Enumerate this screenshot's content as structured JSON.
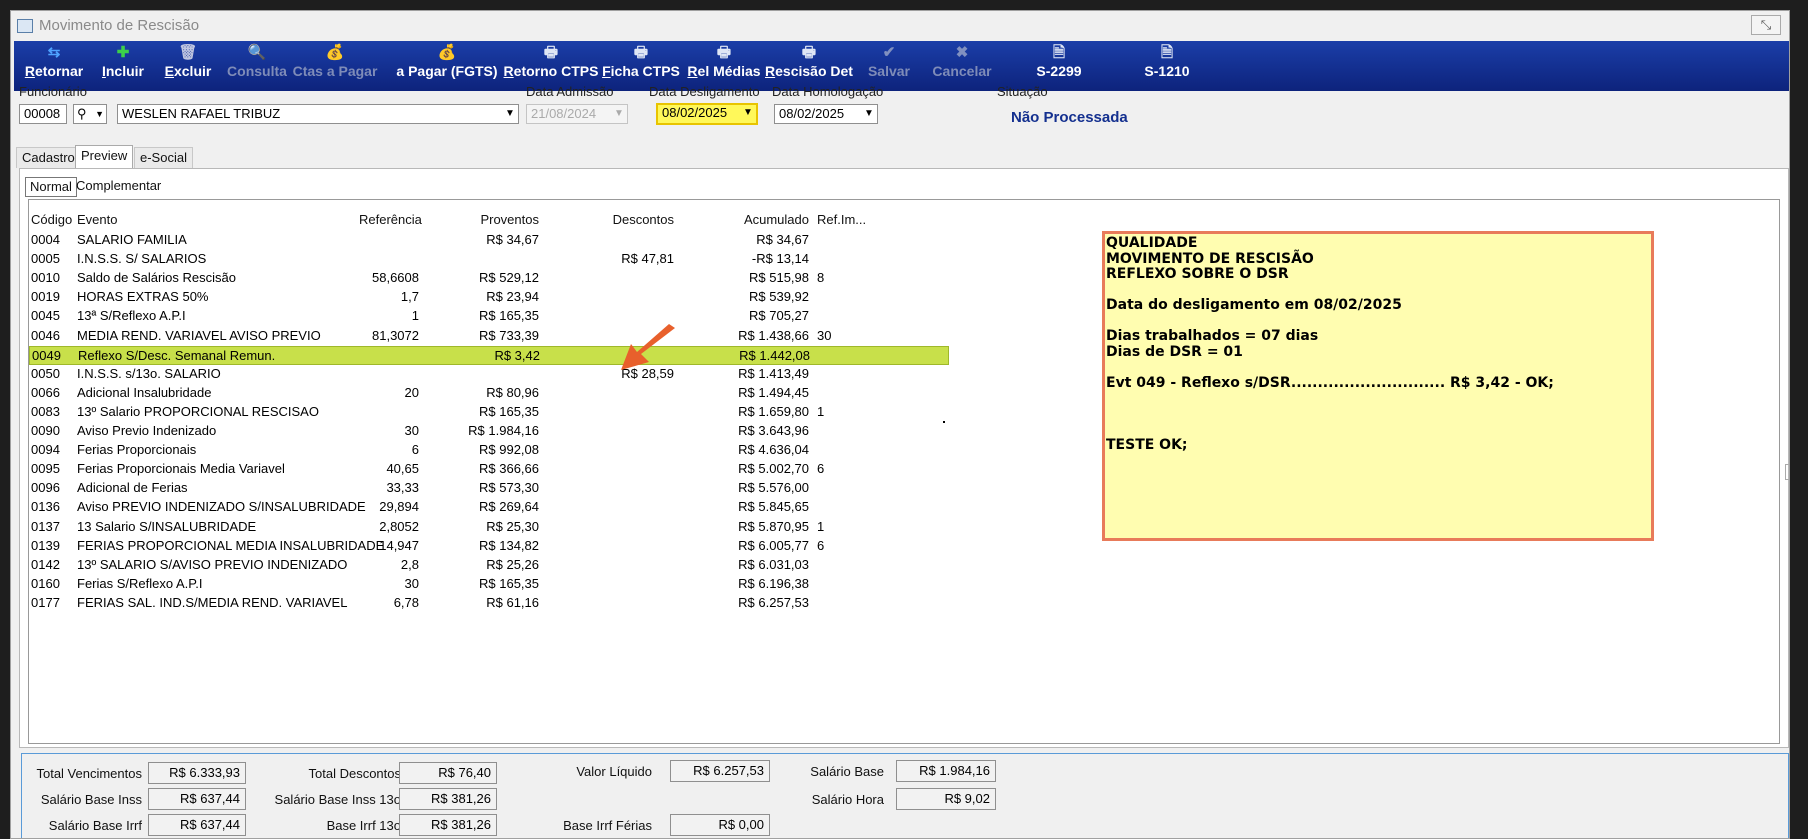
{
  "window": {
    "title": "Movimento de Rescisão",
    "close_glyph": "⤡"
  },
  "toolbar": [
    {
      "key": "retornar",
      "label": "Retornar",
      "icon": "back-arrows-icon",
      "glyph": "⇆",
      "icon_color": "#4fa3ff",
      "enabled": true
    },
    {
      "key": "incluir",
      "label": "Incluir",
      "icon": "plus-icon",
      "glyph": "✚",
      "icon_color": "#3cd04a",
      "enabled": true
    },
    {
      "key": "excluir",
      "label": "Excluir",
      "icon": "trash-icon",
      "glyph": "🗑",
      "icon_color": "#c0c6e0",
      "enabled": true
    },
    {
      "key": "consulta",
      "label": "Consulta",
      "icon": "magnifier-icon",
      "glyph": "🔍",
      "icon_color": "#c0c6e0",
      "enabled": false
    },
    {
      "key": "ctas_pagar",
      "label": "Ctas a Pagar",
      "icon": "money-bag-icon",
      "glyph": "💰",
      "icon_color": "#c0c6e0",
      "enabled": false
    },
    {
      "key": "a_pagar_fgts",
      "label": "a Pagar (FGTS)",
      "icon": "money-bag-green-icon",
      "glyph": "💰",
      "icon_color": "#7fd06a",
      "enabled": true
    },
    {
      "key": "retorno_ctps",
      "label": "Retorno CTPS",
      "icon": "printer-icon",
      "glyph": "🖶",
      "icon_color": "#dfe6f5",
      "enabled": true
    },
    {
      "key": "ficha_ctps",
      "label": "Ficha CTPS",
      "icon": "printer-icon",
      "glyph": "🖶",
      "icon_color": "#dfe6f5",
      "enabled": true
    },
    {
      "key": "rel_medias",
      "label": "Rel Médias",
      "icon": "printer-icon",
      "glyph": "🖶",
      "icon_color": "#dfe6f5",
      "enabled": true
    },
    {
      "key": "rescisao_det",
      "label": "Rescisão Det",
      "icon": "printer-icon",
      "glyph": "🖶",
      "icon_color": "#dfe6f5",
      "enabled": true
    },
    {
      "key": "salvar",
      "label": "Salvar",
      "icon": "checkmark-icon",
      "glyph": "✔",
      "icon_color": "#c0c6e0",
      "enabled": false
    },
    {
      "key": "cancelar",
      "label": "Cancelar",
      "icon": "x-icon",
      "glyph": "✖",
      "icon_color": "#c0c6e0",
      "enabled": false
    },
    {
      "key": "s2299",
      "label": "S-2299",
      "icon": "document-icon",
      "glyph": "🗎",
      "icon_color": "#dfe6f5",
      "enabled": true
    },
    {
      "key": "s1210",
      "label": "S-1210",
      "icon": "document-icon",
      "glyph": "🗎",
      "icon_color": "#dfe6f5",
      "enabled": true
    }
  ],
  "form": {
    "funcionario_label": "Funcionário",
    "funcionario_code": "00008",
    "funcionario_name": "WESLEN RAFAEL TRIBUZ",
    "data_admissao_label": "Data Admissão",
    "data_admissao": "21/08/2024",
    "data_desligamento_label": "Data Desligamento",
    "data_desligamento": "08/02/2025",
    "data_homologacao_label": "Data Homologação",
    "data_homologacao": "08/02/2025",
    "situacao_label": "Situação",
    "situacao": "Não Processada"
  },
  "tabs": [
    "Cadastro",
    "Preview",
    "e-Social"
  ],
  "subtabs": [
    "Normal",
    "Complementar"
  ],
  "grid": {
    "headers": {
      "codigo": "Código",
      "evento": "Evento",
      "referencia": "Referência",
      "proventos": "Proventos",
      "descontos": "Descontos",
      "acumulado": "Acumulado",
      "ref_im": "Ref.Im..."
    },
    "rows": [
      {
        "codigo": "0004",
        "evento": "SALARIO FAMILIA",
        "referencia": "",
        "proventos": "R$ 34,67",
        "descontos": "",
        "acumulado": "R$ 34,67",
        "ref_im": ""
      },
      {
        "codigo": "0005",
        "evento": "I.N.S.S. S/ SALARIOS",
        "referencia": "",
        "proventos": "",
        "descontos": "R$ 47,81",
        "acumulado": "-R$ 13,14",
        "ref_im": ""
      },
      {
        "codigo": "0010",
        "evento": "Saldo de Salários Rescisão",
        "referencia": "58,6608",
        "proventos": "R$ 529,12",
        "descontos": "",
        "acumulado": "R$ 515,98",
        "ref_im": "8"
      },
      {
        "codigo": "0019",
        "evento": "HORAS EXTRAS 50%",
        "referencia": "1,7",
        "proventos": "R$ 23,94",
        "descontos": "",
        "acumulado": "R$ 539,92",
        "ref_im": ""
      },
      {
        "codigo": "0045",
        "evento": "13ª S/Reflexo A.P.I",
        "referencia": "1",
        "proventos": "R$ 165,35",
        "descontos": "",
        "acumulado": "R$ 705,27",
        "ref_im": ""
      },
      {
        "codigo": "0046",
        "evento": "MEDIA REND. VARIAVEL AVISO PREVIO",
        "referencia": "81,3072",
        "proventos": "R$ 733,39",
        "descontos": "",
        "acumulado": "R$ 1.438,66",
        "ref_im": "30"
      },
      {
        "codigo": "0049",
        "evento": "Reflexo S/Desc. Semanal Remun.",
        "referencia": "",
        "proventos": "R$ 3,42",
        "descontos": "",
        "acumulado": "R$ 1.442,08",
        "ref_im": "",
        "selected": true
      },
      {
        "codigo": "0050",
        "evento": "I.N.S.S. s/13o. SALARIO",
        "referencia": "",
        "proventos": "",
        "descontos": "R$ 28,59",
        "acumulado": "R$ 1.413,49",
        "ref_im": ""
      },
      {
        "codigo": "0066",
        "evento": "Adicional Insalubridade",
        "referencia": "20",
        "proventos": "R$ 80,96",
        "descontos": "",
        "acumulado": "R$ 1.494,45",
        "ref_im": ""
      },
      {
        "codigo": "0083",
        "evento": "13º Salario PROPORCIONAL RESCISAO",
        "referencia": "",
        "proventos": "R$ 165,35",
        "descontos": "",
        "acumulado": "R$ 1.659,80",
        "ref_im": "1"
      },
      {
        "codigo": "0090",
        "evento": "Aviso Previo Indenizado",
        "referencia": "30",
        "proventos": "R$ 1.984,16",
        "descontos": "",
        "acumulado": "R$ 3.643,96",
        "ref_im": ""
      },
      {
        "codigo": "0094",
        "evento": "Ferias Proporcionais",
        "referencia": "6",
        "proventos": "R$ 992,08",
        "descontos": "",
        "acumulado": "R$ 4.636,04",
        "ref_im": ""
      },
      {
        "codigo": "0095",
        "evento": "Ferias Proporcionais Media Variavel",
        "referencia": "40,65",
        "proventos": "R$ 366,66",
        "descontos": "",
        "acumulado": "R$ 5.002,70",
        "ref_im": "6"
      },
      {
        "codigo": "0096",
        "evento": "Adicional de Ferias",
        "referencia": "33,33",
        "proventos": "R$ 573,30",
        "descontos": "",
        "acumulado": "R$ 5.576,00",
        "ref_im": ""
      },
      {
        "codigo": "0136",
        "evento": "Aviso PREVIO INDENIZADO S/INSALUBRIDADE",
        "referencia": "29,894",
        "proventos": "R$ 269,64",
        "descontos": "",
        "acumulado": "R$ 5.845,65",
        "ref_im": ""
      },
      {
        "codigo": "0137",
        "evento": "13 Salario S/INSALUBRIDADE",
        "referencia": "2,8052",
        "proventos": "R$ 25,30",
        "descontos": "",
        "acumulado": "R$ 5.870,95",
        "ref_im": "1"
      },
      {
        "codigo": "0139",
        "evento": "FERIAS PROPORCIONAL MEDIA INSALUBRIDADE",
        "referencia": "14,947",
        "proventos": "R$ 134,82",
        "descontos": "",
        "acumulado": "R$ 6.005,77",
        "ref_im": "6"
      },
      {
        "codigo": "0142",
        "evento": "13º SALARIO S/AVISO PREVIO INDENIZADO",
        "referencia": "2,8",
        "proventos": "R$ 25,26",
        "descontos": "",
        "acumulado": "R$ 6.031,03",
        "ref_im": ""
      },
      {
        "codigo": "0160",
        "evento": "Ferias S/Reflexo A.P.I",
        "referencia": "30",
        "proventos": "R$ 165,35",
        "descontos": "",
        "acumulado": "R$ 6.196,38",
        "ref_im": ""
      },
      {
        "codigo": "0177",
        "evento": "FERIAS SAL. IND.S/MEDIA REND. VARIAVEL",
        "referencia": "6,78",
        "proventos": "R$ 61,16",
        "descontos": "",
        "acumulado": "R$ 6.257,53",
        "ref_im": ""
      }
    ]
  },
  "note": {
    "lines": [
      "QUALIDADE",
      "MOVIMENTO DE RESCISÃO",
      "REFLEXO SOBRE O DSR",
      "",
      "Data do desligamento em 08/02/2025",
      "",
      "Dias trabalhados = 07 dias",
      "Dias de DSR = 01",
      "",
      "Evt 049 - Reflexo s/DSR............................. R$ 3,42 - OK;",
      "",
      "",
      "",
      "TESTE OK;"
    ],
    "border_color": "#e87b5a",
    "background": "#fffdb0"
  },
  "annotation_arrow": {
    "color": "#e8602c"
  },
  "footer": {
    "total_vencimentos_label": "Total Vencimentos",
    "total_vencimentos": "R$ 6.333,93",
    "total_descontos_label": "Total Descontos",
    "total_descontos": "R$ 76,40",
    "valor_liquido_label": "Valor Líquido",
    "valor_liquido": "R$ 6.257,53",
    "salario_base_label": "Salário Base",
    "salario_base": "R$ 1.984,16",
    "salario_base_inss_label": "Salário Base Inss",
    "salario_base_inss": "R$ 637,44",
    "salario_base_inss13_label": "Salário Base Inss 13o",
    "salario_base_inss13": "R$ 381,26",
    "salario_hora_label": "Salário Hora",
    "salario_hora": "R$ 9,02",
    "salario_base_irrf_label": "Salário Base Irrf",
    "salario_base_irrf": "R$ 637,44",
    "base_irrf13_label": "Base Irrf 13o",
    "base_irrf13": "R$ 381,26",
    "base_irrf_ferias_label": "Base Irrf Férias",
    "base_irrf_ferias": "R$ 0,00"
  }
}
